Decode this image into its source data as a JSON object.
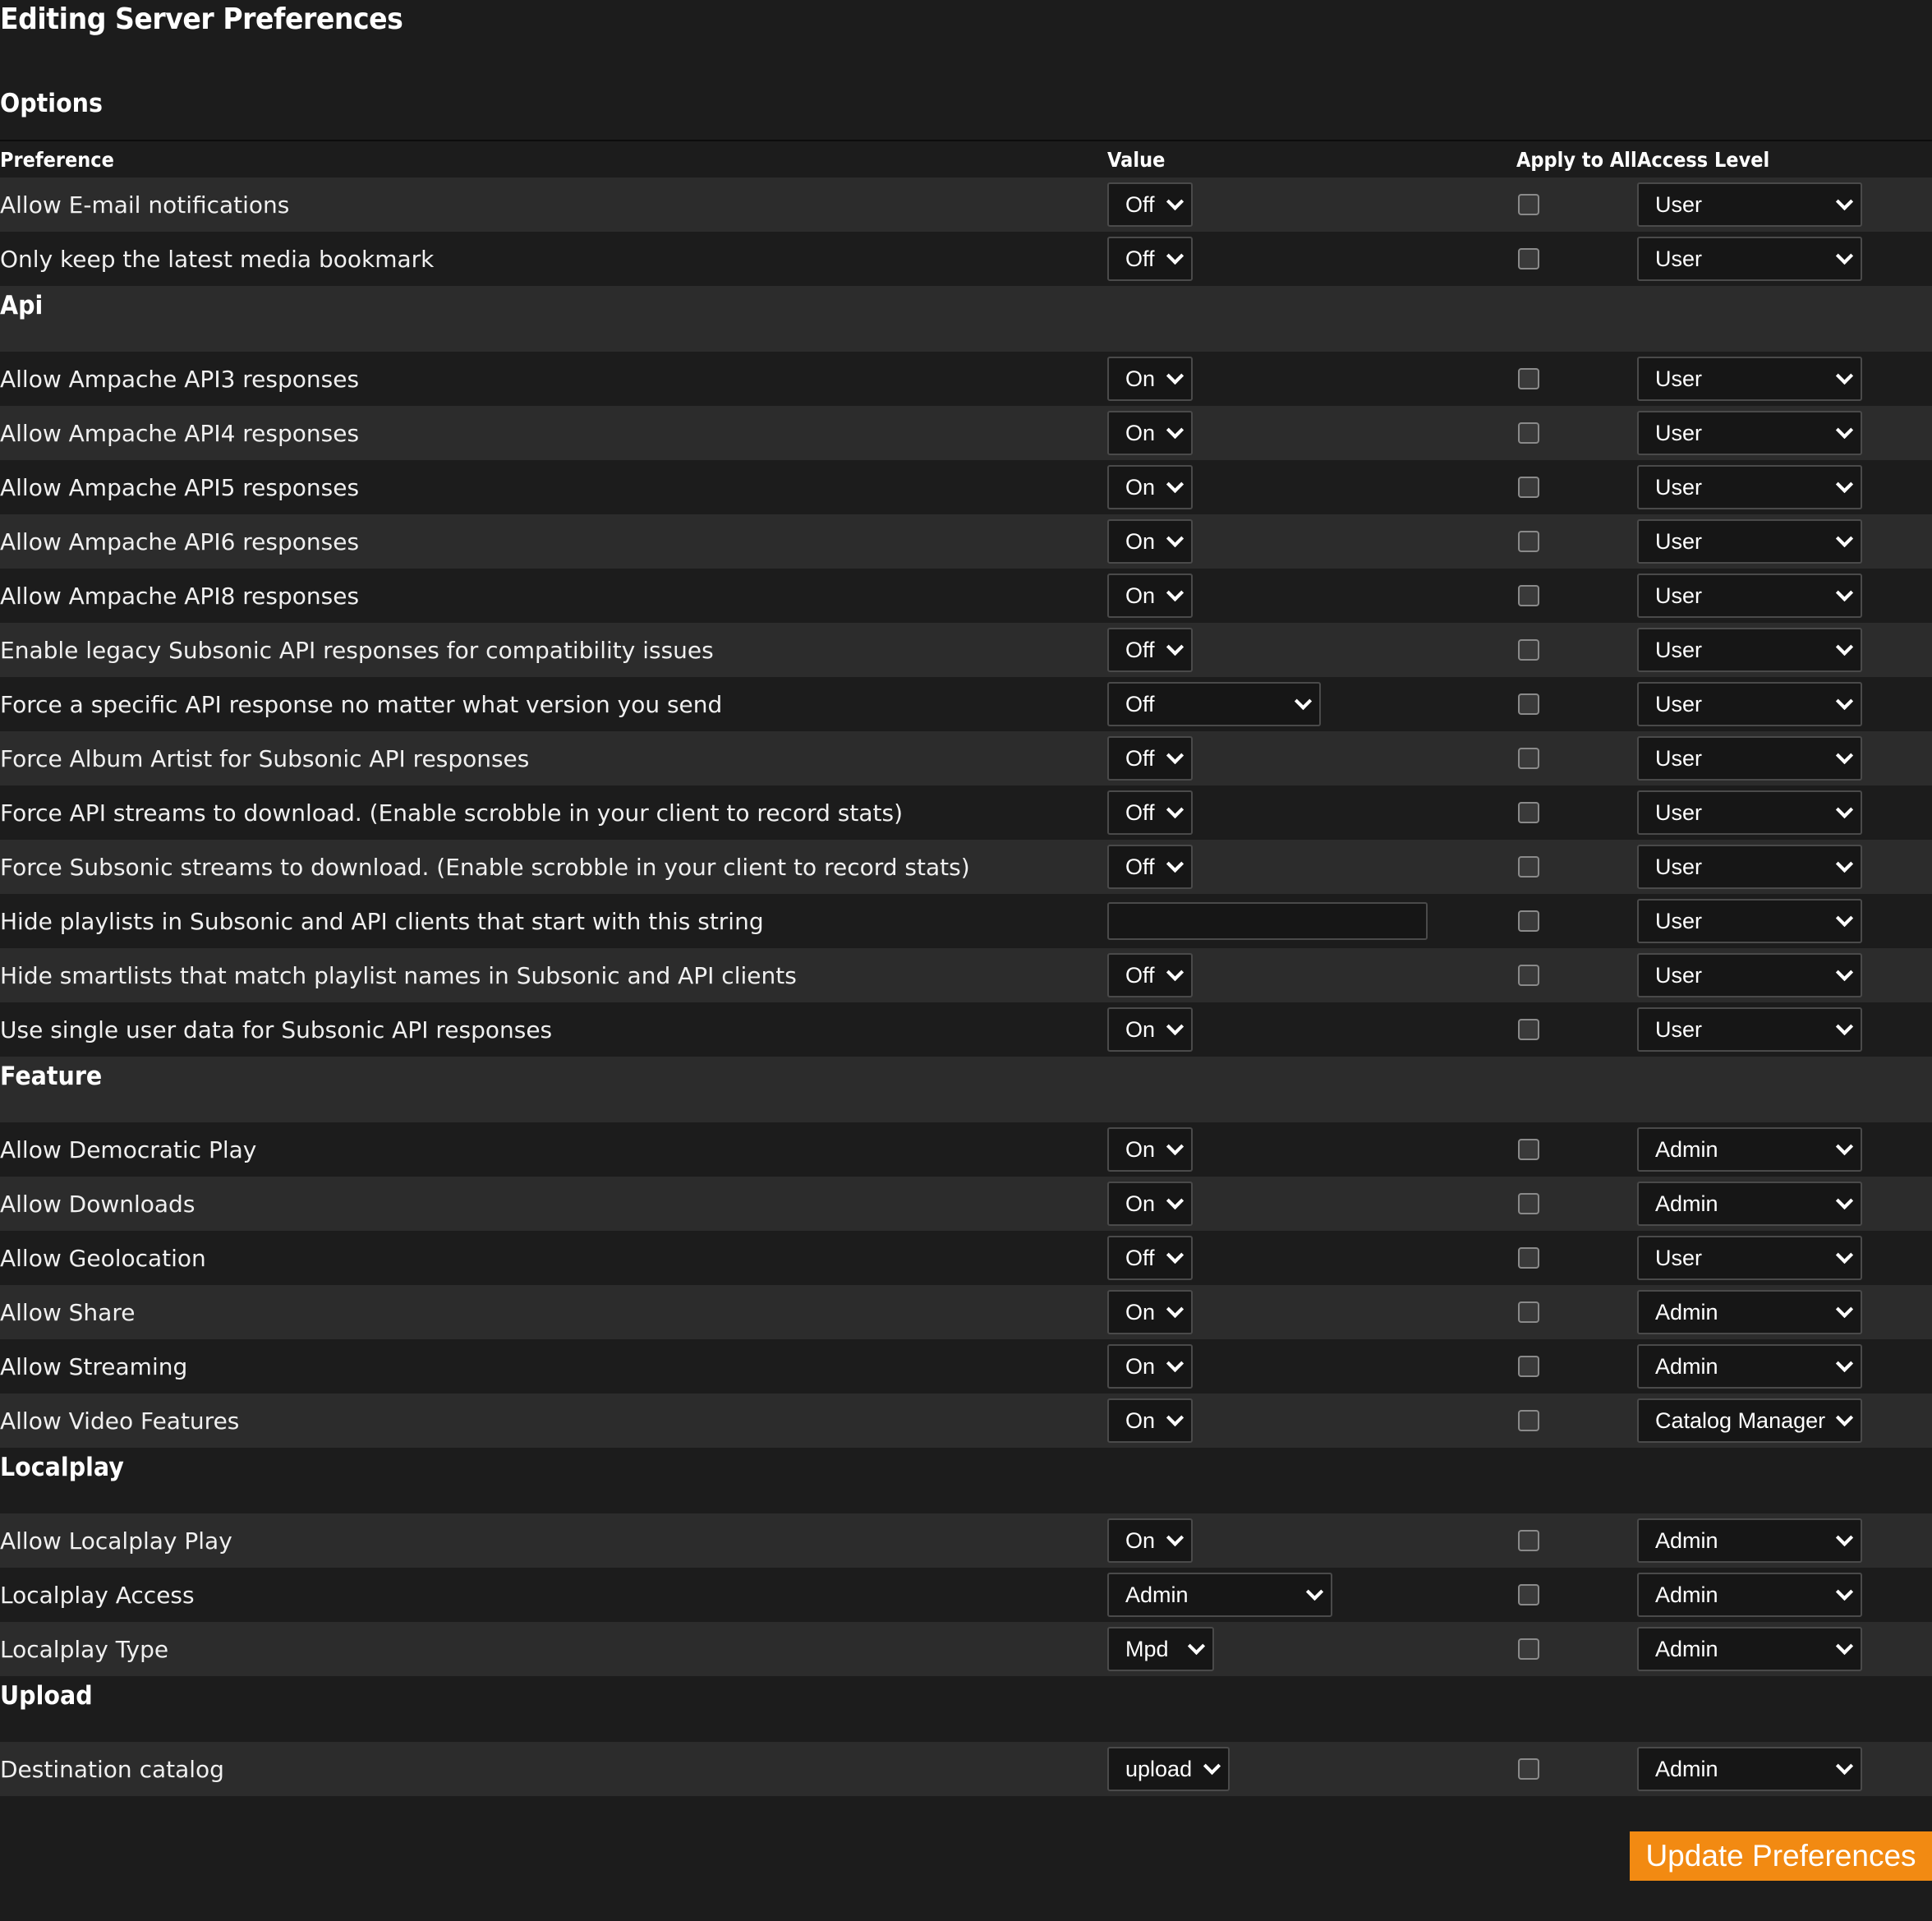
{
  "page": {
    "title": "Editing Server Preferences",
    "options_heading": "Options",
    "update_button": "Update Preferences"
  },
  "table": {
    "headers": {
      "preference": "Preference",
      "value": "Value",
      "apply_to_all": "Apply to All",
      "access_level": "Access Level"
    },
    "groups": [
      {
        "section": "",
        "rows": [
          {
            "label": "Allow E-mail notifications",
            "value": "Off",
            "level": "User"
          },
          {
            "label": "Only keep the latest media bookmark",
            "value": "Off",
            "level": "User"
          }
        ]
      },
      {
        "section": "Api",
        "rows": [
          {
            "label": "Allow Ampache API3 responses",
            "value": "On",
            "level": "User"
          },
          {
            "label": "Allow Ampache API4 responses",
            "value": "On",
            "level": "User"
          },
          {
            "label": "Allow Ampache API5 responses",
            "value": "On",
            "level": "User"
          },
          {
            "label": "Allow Ampache API6 responses",
            "value": "On",
            "level": "User"
          },
          {
            "label": "Allow Ampache API8 responses",
            "value": "On",
            "level": "User"
          },
          {
            "label": "Enable legacy Subsonic API responses for compatibility issues",
            "value": "Off",
            "level": "User"
          },
          {
            "label": "Force a specific API response no matter what version you send",
            "value": "Off",
            "level": "User"
          },
          {
            "label": "Force Album Artist for Subsonic API responses",
            "value": "Off",
            "level": "User"
          },
          {
            "label": "Force API streams to download. (Enable scrobble in your client to record stats)",
            "value": "Off",
            "level": "User"
          },
          {
            "label": "Force Subsonic streams to download. (Enable scrobble in your client to record stats)",
            "value": "Off",
            "level": "User"
          },
          {
            "label": "Hide playlists in Subsonic and API clients that start with this string",
            "value": "",
            "level": "User"
          },
          {
            "label": "Hide smartlists that match playlist names in Subsonic and API clients",
            "value": "Off",
            "level": "User"
          },
          {
            "label": "Use single user data for Subsonic API responses",
            "value": "On",
            "level": "User"
          }
        ]
      },
      {
        "section": "Feature",
        "rows": [
          {
            "label": "Allow Democratic Play",
            "value": "On",
            "level": "Admin"
          },
          {
            "label": "Allow Downloads",
            "value": "On",
            "level": "Admin"
          },
          {
            "label": "Allow Geolocation",
            "value": "Off",
            "level": "User"
          },
          {
            "label": "Allow Share",
            "value": "On",
            "level": "Admin"
          },
          {
            "label": "Allow Streaming",
            "value": "On",
            "level": "Admin"
          },
          {
            "label": "Allow Video Features",
            "value": "On",
            "level": "Catalog Manager"
          }
        ]
      },
      {
        "section": "Localplay",
        "rows": [
          {
            "label": "Allow Localplay Play",
            "value": "On",
            "level": "Admin"
          },
          {
            "label": "Localplay Access",
            "value": "Admin",
            "level": "Admin"
          },
          {
            "label": "Localplay Type",
            "value": "Mpd",
            "level": "Admin"
          }
        ]
      },
      {
        "section": "Upload",
        "rows": [
          {
            "label": "Destination catalog",
            "value": "upload",
            "level": "Admin"
          }
        ]
      }
    ]
  }
}
